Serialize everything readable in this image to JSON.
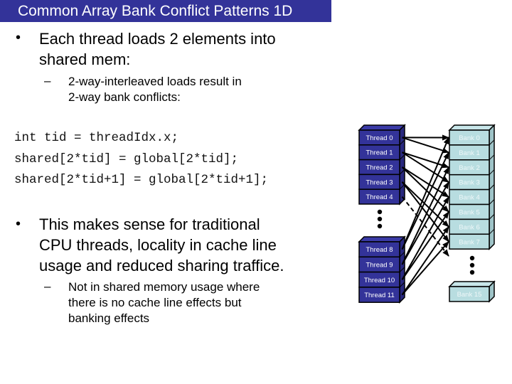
{
  "slide": {
    "title": "Common Array Bank Conflict Patterns 1D",
    "bullet1": {
      "marker": "•",
      "lines": [
        "Each thread loads 2 elements into",
        "shared mem:"
      ]
    },
    "sub1": {
      "marker": "–",
      "lines": [
        "2-way-interleaved loads result in",
        "2-way bank conflicts:"
      ]
    },
    "code": [
      "int tid = threadIdx.x;",
      "shared[2*tid] = global[2*tid];",
      "shared[2*tid+1] = global[2*tid+1];"
    ],
    "bullet2": {
      "marker": "•",
      "lines": [
        "This makes sense for traditional",
        "CPU threads, locality in cache line",
        "usage and reduced sharing traffice."
      ]
    },
    "sub2": {
      "marker": "–",
      "lines": [
        "Not in shared memory usage where",
        "there is no cache line effects but",
        "banking effects"
      ]
    }
  },
  "diagram": {
    "colors": {
      "thread_fill": "#333399",
      "bank_fill": "#b8dde0",
      "bank_text": "#eef7f8",
      "arrow": "#000000"
    },
    "threads_top": [
      "Thread 0",
      "Thread 1",
      "Thread 2",
      "Thread 3",
      "Thread 4"
    ],
    "threads_bottom": [
      "Thread 8",
      "Thread 9",
      "Thread 10",
      "Thread 11"
    ],
    "banks": [
      "Bank 0",
      "Bank 1",
      "Bank 2",
      "Bank 3",
      "Bank 4",
      "Bank 5",
      "Bank 6",
      "Bank 7"
    ],
    "bank_last": "Bank 15",
    "connections": [
      {
        "from": "Thread 0",
        "to": "Bank 0"
      },
      {
        "from": "Thread 0",
        "to": "Bank 1"
      },
      {
        "from": "Thread 1",
        "to": "Bank 2"
      },
      {
        "from": "Thread 1",
        "to": "Bank 3"
      },
      {
        "from": "Thread 2",
        "to": "Bank 4"
      },
      {
        "from": "Thread 2",
        "to": "Bank 5"
      },
      {
        "from": "Thread 3",
        "to": "Bank 6"
      },
      {
        "from": "Thread 3",
        "to": "Bank 7"
      },
      {
        "from": "Thread 4",
        "to": "Bank 8",
        "dashed": true
      },
      {
        "from": "Thread 8",
        "to": "Bank 0"
      },
      {
        "from": "Thread 8",
        "to": "Bank 1"
      },
      {
        "from": "Thread 9",
        "to": "Bank 2"
      },
      {
        "from": "Thread 9",
        "to": "Bank 3"
      },
      {
        "from": "Thread 10",
        "to": "Bank 4"
      },
      {
        "from": "Thread 10",
        "to": "Bank 5"
      },
      {
        "from": "Thread 11",
        "to": "Bank 6"
      },
      {
        "from": "Thread 11",
        "to": "Bank 7"
      }
    ]
  }
}
